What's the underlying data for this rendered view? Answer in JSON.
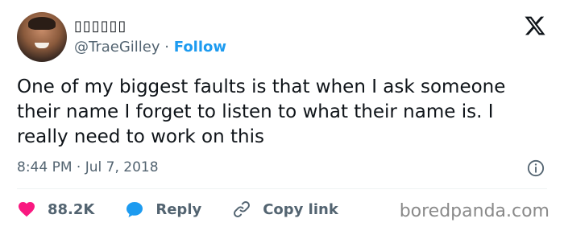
{
  "author": {
    "display_name": "▯▯▯▯▯▯",
    "handle": "@TraeGilley",
    "separator": "·",
    "follow_label": "Follow"
  },
  "tweet": {
    "text": "One of my biggest faults is that when I ask someone their name I forget to listen to what their name is. I really need to work on this",
    "timestamp": "8:44 PM · Jul 7, 2018"
  },
  "actions": {
    "likes": "88.2K",
    "reply_label": "Reply",
    "copy_link_label": "Copy link"
  },
  "watermark": "boredpanda.com",
  "colors": {
    "accent": "#1d9bf0",
    "like": "#f91880",
    "text": "#0f1419",
    "muted": "#536471"
  }
}
